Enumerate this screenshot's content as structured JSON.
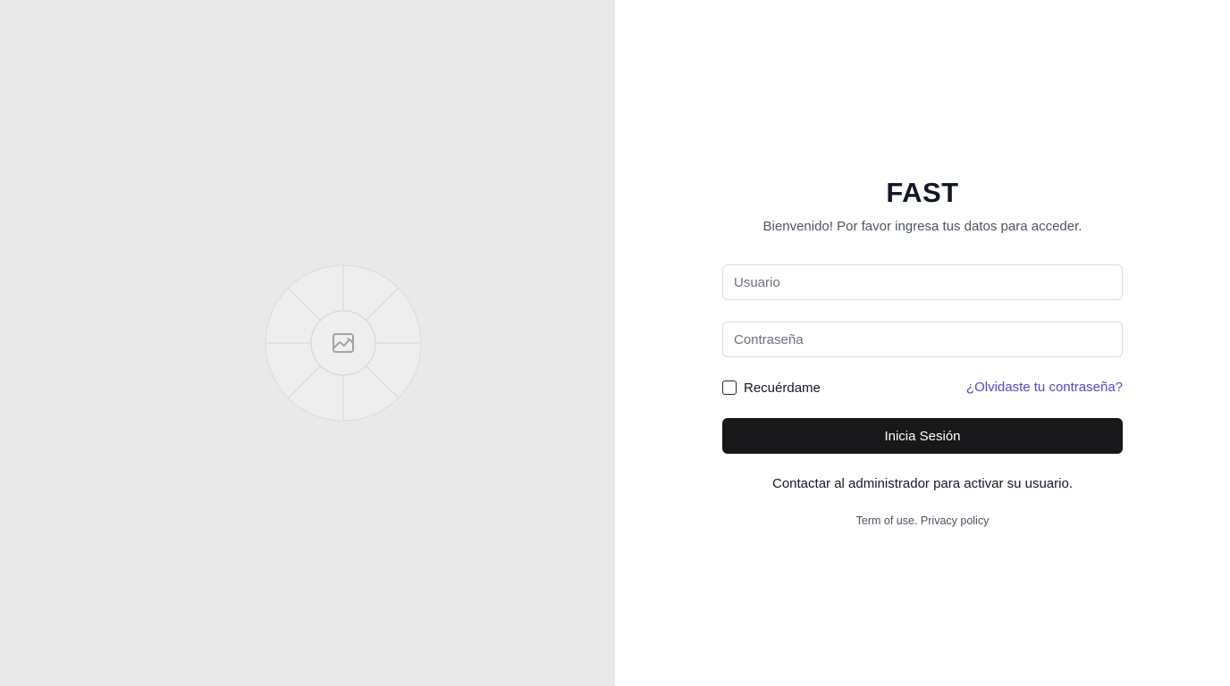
{
  "left_panel": {
    "background": "#e9e9e9",
    "graphic_icon": "image-placeholder-icon"
  },
  "login": {
    "brand_title": "FAST",
    "subtitle": "Bienvenido! Por favor ingresa tus datos para acceder.",
    "username": {
      "placeholder": "Usuario",
      "value": ""
    },
    "password": {
      "placeholder": "Contraseña",
      "value": ""
    },
    "remember_label": "Recuérdame",
    "remember_checked": false,
    "forgot_link": "¿Olvidaste tu contraseña?",
    "submit_label": "Inicia Sesión",
    "contact_note": "Contactar al administrador para activar su usuario.",
    "legal": {
      "terms": "Term of use.",
      "privacy": "Privacy policy"
    }
  },
  "colors": {
    "brand_text": "#111827",
    "link": "#4f46e5",
    "button": "#18181b",
    "border": "#dcdcdc"
  }
}
